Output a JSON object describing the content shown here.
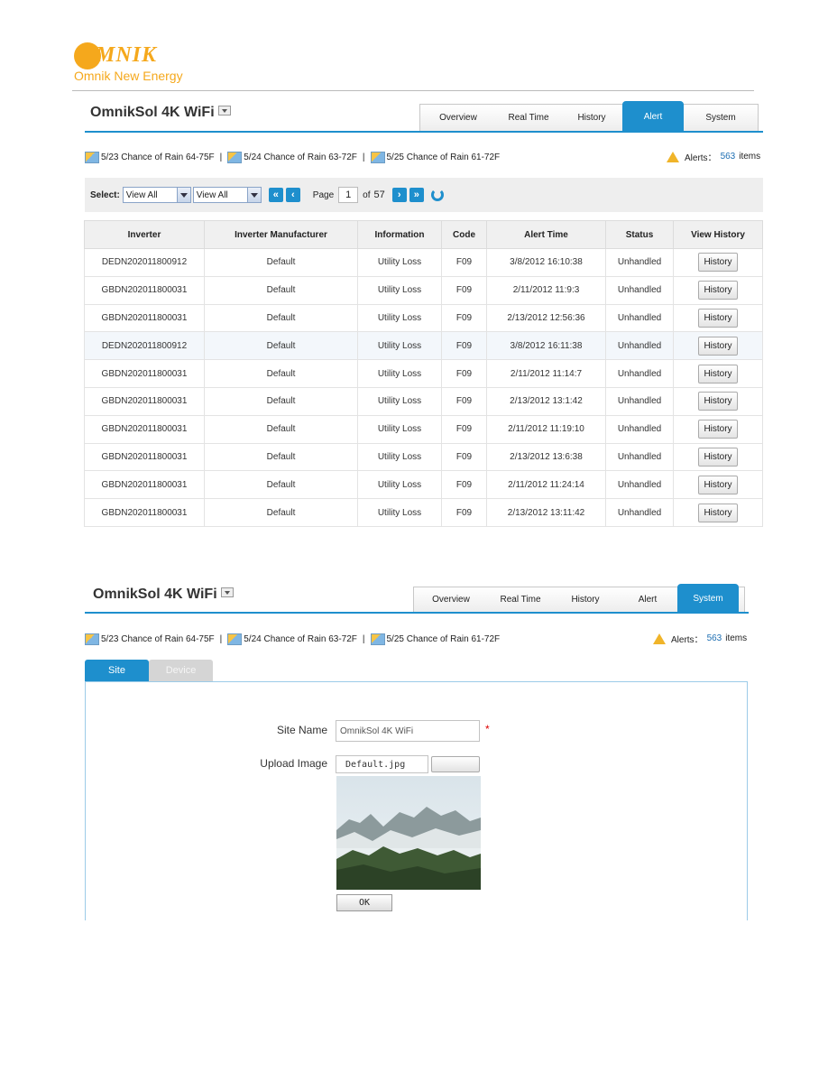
{
  "logo": {
    "word": "MNIK",
    "tagline": "Omnik New Energy"
  },
  "alert_panel": {
    "site_title": "OmnikSol 4K WiFi",
    "tabs": [
      "Overview",
      "Real Time",
      "History",
      "Alert",
      "System"
    ],
    "active_tab": "Alert",
    "weather": [
      "5/23 Chance of Rain 64-75F",
      "5/24 Chance of Rain 63-72F",
      "5/25 Chance of Rain 61-72F"
    ],
    "weather_sep": "|",
    "alerts": {
      "label": "Alerts：",
      "count": "563",
      "suffix": "items"
    },
    "select": {
      "label": "Select:",
      "options": [
        "View All",
        "View All"
      ],
      "page_label": "Page",
      "page": "1",
      "of_label": "of",
      "total_pages": "57"
    },
    "table": {
      "columns": [
        "Inverter",
        "Inverter Manufacturer",
        "Information",
        "Code",
        "Alert Time",
        "Status",
        "View History"
      ],
      "button_label": "History",
      "rows": [
        [
          "DEDN202011800912",
          "Default",
          "Utility Loss",
          "F09",
          "3/8/2012 16:10:38",
          "Unhandled"
        ],
        [
          "GBDN202011800031",
          "Default",
          "Utility Loss",
          "F09",
          "2/11/2012 11:9:3",
          "Unhandled"
        ],
        [
          "GBDN202011800031",
          "Default",
          "Utility Loss",
          "F09",
          "2/13/2012 12:56:36",
          "Unhandled"
        ],
        [
          "DEDN202011800912",
          "Default",
          "Utility Loss",
          "F09",
          "3/8/2012 16:11:38",
          "Unhandled"
        ],
        [
          "GBDN202011800031",
          "Default",
          "Utility Loss",
          "F09",
          "2/11/2012 11:14:7",
          "Unhandled"
        ],
        [
          "GBDN202011800031",
          "Default",
          "Utility Loss",
          "F09",
          "2/13/2012 13:1:42",
          "Unhandled"
        ],
        [
          "GBDN202011800031",
          "Default",
          "Utility Loss",
          "F09",
          "2/11/2012 11:19:10",
          "Unhandled"
        ],
        [
          "GBDN202011800031",
          "Default",
          "Utility Loss",
          "F09",
          "2/13/2012 13:6:38",
          "Unhandled"
        ],
        [
          "GBDN202011800031",
          "Default",
          "Utility Loss",
          "F09",
          "2/11/2012 11:24:14",
          "Unhandled"
        ],
        [
          "GBDN202011800031",
          "Default",
          "Utility Loss",
          "F09",
          "2/13/2012 13:11:42",
          "Unhandled"
        ]
      ]
    }
  },
  "system_panel": {
    "site_title": "OmnikSol 4K WiFi",
    "tabs": [
      "Overview",
      "Real Time",
      "History",
      "Alert",
      "System"
    ],
    "active_tab": "System",
    "weather": [
      "5/23 Chance of Rain 64-75F",
      "5/24 Chance of Rain 63-72F",
      "5/25 Chance of Rain 61-72F"
    ],
    "weather_sep": "|",
    "alerts": {
      "label": "Alerts：",
      "count": "563",
      "suffix": "items"
    },
    "subtabs": [
      "Site",
      "Device"
    ],
    "form": {
      "site_name_label": "Site Name",
      "site_name_value": "OmnikSol 4K WiFi",
      "required_mark": "*",
      "upload_label": "Upload Image",
      "upload_value": "Default.jpg",
      "ok_label": "OK"
    }
  },
  "colors": {
    "accent": "#1e8fcd",
    "brand": "#f5a81c",
    "alert_count": "#1e6fb3"
  }
}
